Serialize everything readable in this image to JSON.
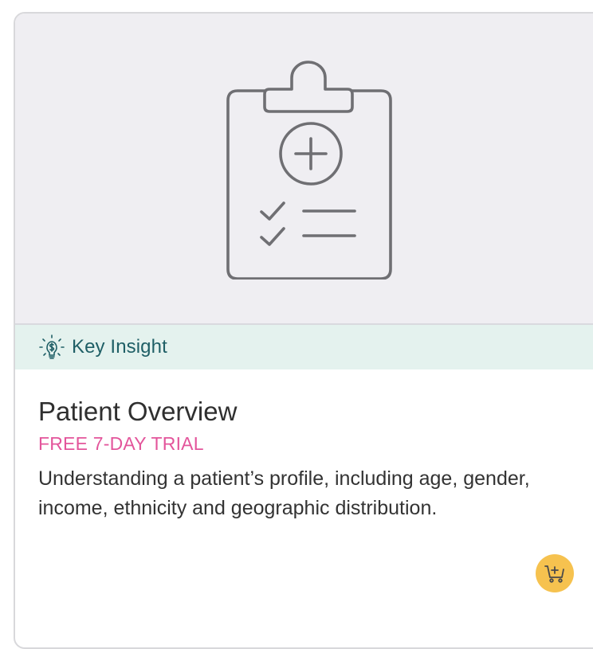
{
  "card": {
    "badge_label": "Key Insight",
    "title": "Patient Overview",
    "trial_label": "FREE 7-DAY TRIAL",
    "description": "Understanding a patient’s profile, including age, gender, income, ethnicity and geographic distribution."
  },
  "icons": {
    "hero": "clipboard-medical-check-icon",
    "badge": "lightbulb-dollar-icon",
    "cart": "add-to-cart-icon"
  },
  "colors": {
    "hero_bg": "#efeef2",
    "insight_bg": "#e4f2ee",
    "insight_text": "#1f5f66",
    "trial_text": "#e3559b",
    "cart_button": "#f6c24f"
  }
}
